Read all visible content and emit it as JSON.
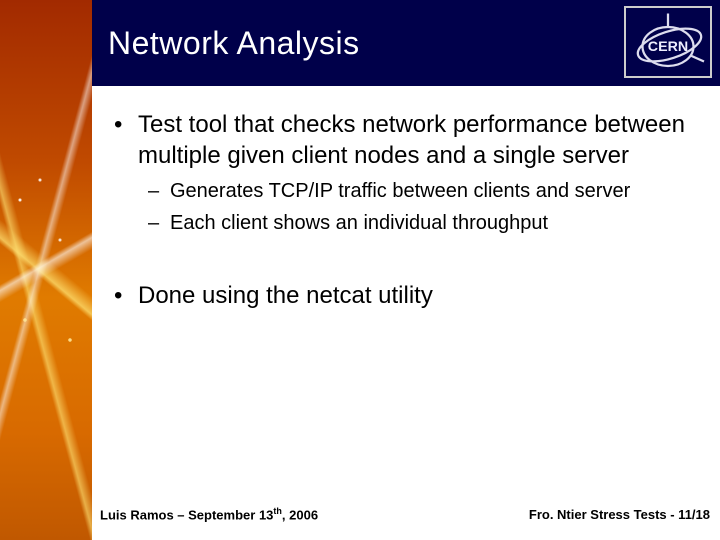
{
  "title": "Network Analysis",
  "logo": {
    "text": "CERN",
    "name": "cern-logo"
  },
  "bullets": {
    "item1": "Test tool that checks network performance between multiple given client nodes and a single server",
    "sub1": "Generates TCP/IP traffic between clients and server",
    "sub2": "Each client shows an individual throughput",
    "item2": "Done using the netcat utility"
  },
  "footer": {
    "author": "Luis Ramos ",
    "sep": "– ",
    "date_pre": "September 13",
    "date_sup": "th",
    "date_post": ", 2006",
    "right": "Fro. Ntier Stress Tests - 11/18"
  }
}
